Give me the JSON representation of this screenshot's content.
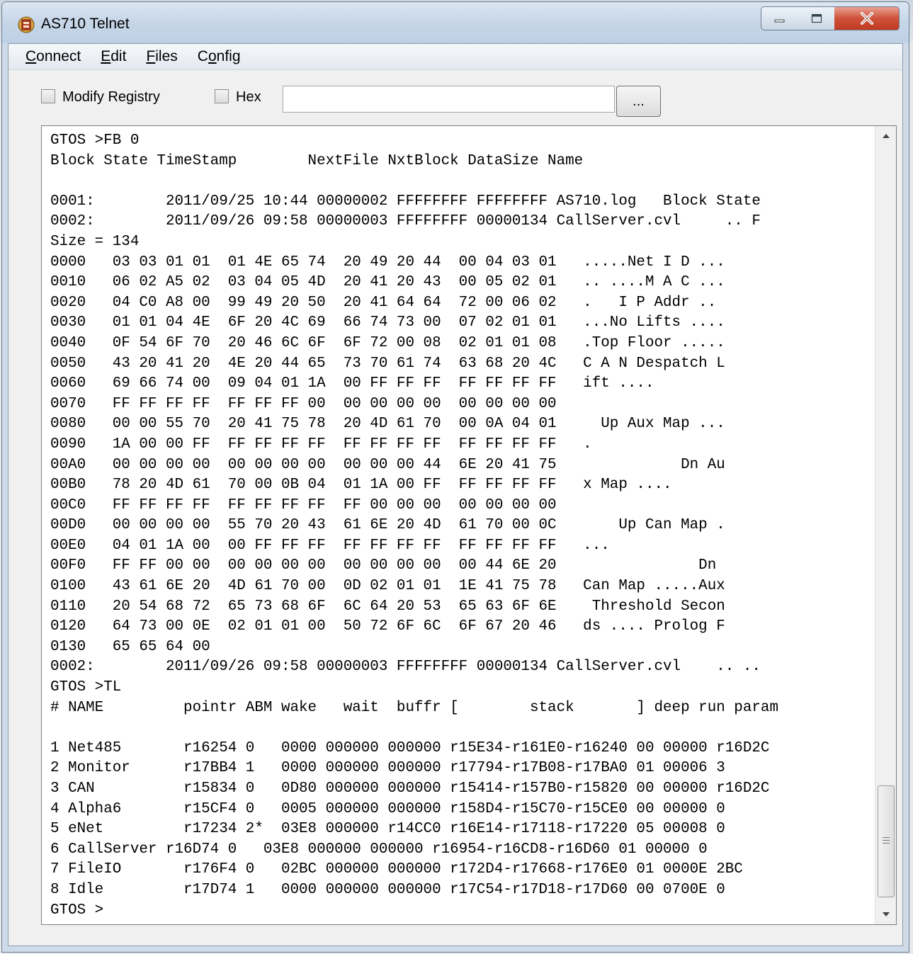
{
  "window": {
    "title": "AS710 Telnet"
  },
  "menu": {
    "items": [
      {
        "label_u": "C",
        "label_rest": "onnect"
      },
      {
        "label_u": "E",
        "label_rest": "dit"
      },
      {
        "label_u": "F",
        "label_rest": "iles"
      },
      {
        "label_pre": "C",
        "label_u": "o",
        "label_rest": "nfig"
      }
    ]
  },
  "toolbar": {
    "modify_registry_label": "Modify Registry",
    "hex_label": "Hex",
    "hex_value": "",
    "browse_label": "..."
  },
  "terminal": {
    "text": "GTOS >FB 0\nBlock State TimeStamp        NextFile NxtBlock DataSize Name\n\n0001:        2011/09/25 10:44 00000002 FFFFFFFF FFFFFFFF AS710.log   Block State\n0002:        2011/09/26 09:58 00000003 FFFFFFFF 00000134 CallServer.cvl     .. F\nSize = 134\n0000   03 03 01 01  01 4E 65 74  20 49 20 44  00 04 03 01   .....Net I D ...\n0010   06 02 A5 02  03 04 05 4D  20 41 20 43  00 05 02 01   .. ....M A C ...\n0020   04 C0 A8 00  99 49 20 50  20 41 64 64  72 00 06 02   .   I P Addr ..\n0030   01 01 04 4E  6F 20 4C 69  66 74 73 00  07 02 01 01   ...No Lifts ....\n0040   0F 54 6F 70  20 46 6C 6F  6F 72 00 08  02 01 01 08   .Top Floor .....\n0050   43 20 41 20  4E 20 44 65  73 70 61 74  63 68 20 4C   C A N Despatch L\n0060   69 66 74 00  09 04 01 1A  00 FF FF FF  FF FF FF FF   ift ....\n0070   FF FF FF FF  FF FF FF 00  00 00 00 00  00 00 00 00\n0080   00 00 55 70  20 41 75 78  20 4D 61 70  00 0A 04 01     Up Aux Map ...\n0090   1A 00 00 FF  FF FF FF FF  FF FF FF FF  FF FF FF FF   .\n00A0   00 00 00 00  00 00 00 00  00 00 00 44  6E 20 41 75              Dn Au\n00B0   78 20 4D 61  70 00 0B 04  01 1A 00 FF  FF FF FF FF   x Map ....\n00C0   FF FF FF FF  FF FF FF FF  FF 00 00 00  00 00 00 00\n00D0   00 00 00 00  55 70 20 43  61 6E 20 4D  61 70 00 0C       Up Can Map .\n00E0   04 01 1A 00  00 FF FF FF  FF FF FF FF  FF FF FF FF   ...\n00F0   FF FF 00 00  00 00 00 00  00 00 00 00  00 44 6E 20                Dn\n0100   43 61 6E 20  4D 61 70 00  0D 02 01 01  1E 41 75 78   Can Map .....Aux\n0110   20 54 68 72  65 73 68 6F  6C 64 20 53  65 63 6F 6E    Threshold Secon\n0120   64 73 00 0E  02 01 01 00  50 72 6F 6C  6F 67 20 46   ds .... Prolog F\n0130   65 65 64 00\n0002:        2011/09/26 09:58 00000003 FFFFFFFF 00000134 CallServer.cvl    .. ..\nGTOS >TL\n# NAME         pointr ABM wake   wait  buffr [        stack       ] deep run param\n\n1 Net485       r16254 0   0000 000000 000000 r15E34-r161E0-r16240 00 00000 r16D2C\n2 Monitor      r17BB4 1   0000 000000 000000 r17794-r17B08-r17BA0 01 00006 3\n3 CAN          r15834 0   0D80 000000 000000 r15414-r157B0-r15820 00 00000 r16D2C\n4 Alpha6       r15CF4 0   0005 000000 000000 r158D4-r15C70-r15CE0 00 00000 0\n5 eNet         r17234 2*  03E8 000000 r14CC0 r16E14-r17118-r17220 05 00008 0\n6 CallServer r16D74 0   03E8 000000 000000 r16954-r16CD8-r16D60 01 00000 0\n7 FileIO       r176F4 0   02BC 000000 000000 r172D4-r17668-r176E0 01 0000E 2BC\n8 Idle         r17D74 1   0000 000000 000000 r17C54-r17D18-r17D60 00 0700E 0\nGTOS >"
  }
}
